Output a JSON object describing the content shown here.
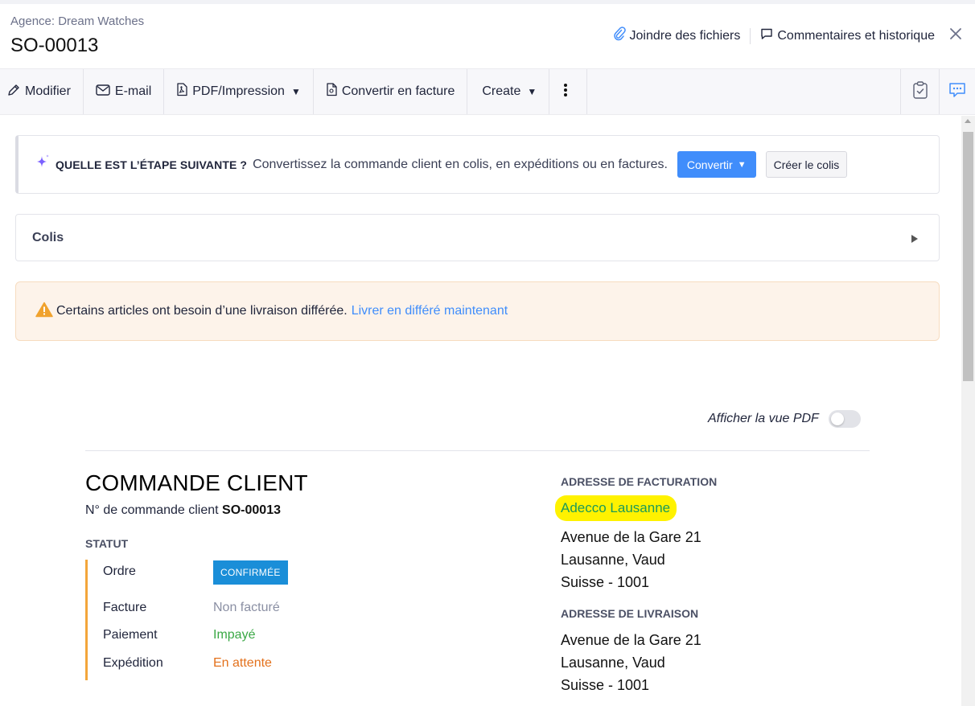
{
  "header": {
    "org_label": "Agence: Dream Watches",
    "title": "SO-00013",
    "attach_label": "Joindre des fichiers",
    "comments_label": "Commentaires et historique"
  },
  "toolbar": {
    "edit": "Modifier",
    "email": "E-mail",
    "pdf": "PDF/Impression",
    "convert_invoice": "Convertir en facture",
    "create": "Create"
  },
  "next_step": {
    "title": "QUELLE EST L’ÉTAPE SUIVANTE ?",
    "text": "Convertissez la commande client en colis, en expéditions ou en factures.",
    "convert_button": "Convertir",
    "create_package_button": "Créer le colis"
  },
  "colis": {
    "title": "Colis"
  },
  "warning": {
    "text": "Certains articles ont besoin d’une livraison différée.",
    "link": "Livrer en différé maintenant"
  },
  "pdf_view": {
    "label": "Afficher la vue PDF",
    "enabled": false
  },
  "document": {
    "title": "COMMANDE CLIENT",
    "number_label": "N° de commande client",
    "number": "SO-00013",
    "status_heading": "STATUT",
    "statuses": [
      {
        "label": "Ordre",
        "value": "CONFIRMÉE",
        "color": "#1a8ed8"
      },
      {
        "label": "Facture",
        "value": "Non facturé",
        "color": "#8a8fa3"
      },
      {
        "label": "Paiement",
        "value": "Impayé",
        "color": "#3aa845"
      },
      {
        "label": "Expédition",
        "value": "En attente",
        "color": "#e3711c"
      }
    ],
    "billing": {
      "heading": "ADRESSE DE FACTURATION",
      "name": "Adecco Lausanne",
      "line1": "Avenue de la Gare 21",
      "line2": "Lausanne, Vaud",
      "line3": "Suisse - 1001"
    },
    "shipping": {
      "heading": "ADRESSE DE LIVRAISON",
      "line1": "Avenue de la Gare 21",
      "line2": "Lausanne, Vaud",
      "line3": "Suisse - 1001"
    }
  },
  "colors": {
    "primary": "#408dfb",
    "highlight": "#fff200",
    "status_bar": "#f3a63b",
    "warning_bg": "#fdf3ea",
    "sparkle": "#7b61ff"
  }
}
